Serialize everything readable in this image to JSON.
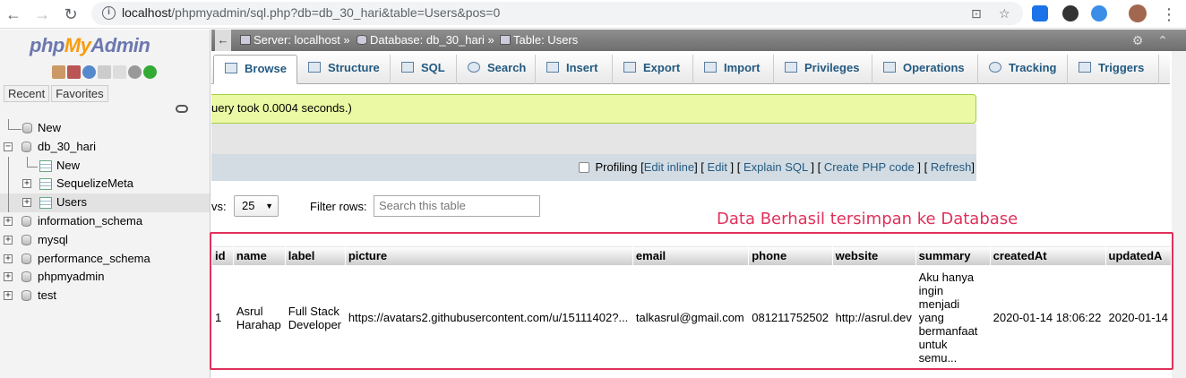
{
  "browser": {
    "url_host": "localhost",
    "url_path": "/phpmyadmin/sql.php?db=db_30_hari&table=Users&pos=0"
  },
  "sidebar": {
    "logo_php": "php",
    "logo_my": "My",
    "logo_admin": "Admin",
    "recent_label": "Recent",
    "favorites_label": "Favorites",
    "tree": [
      {
        "label": "New"
      },
      {
        "label": "db_30_hari"
      },
      {
        "label": "New"
      },
      {
        "label": "SequelizeMeta"
      },
      {
        "label": "Users"
      },
      {
        "label": "information_schema"
      },
      {
        "label": "mysql"
      },
      {
        "label": "performance_schema"
      },
      {
        "label": "phpmyadmin"
      },
      {
        "label": "test"
      }
    ]
  },
  "breadcrumb": {
    "server": "Server: localhost »",
    "database": "Database: db_30_hari »",
    "table": "Table: Users"
  },
  "tabs": [
    {
      "label": "Browse"
    },
    {
      "label": "Structure"
    },
    {
      "label": "SQL"
    },
    {
      "label": "Search"
    },
    {
      "label": "Insert"
    },
    {
      "label": "Export"
    },
    {
      "label": "Import"
    },
    {
      "label": "Privileges"
    },
    {
      "label": "Operations"
    },
    {
      "label": "Tracking"
    },
    {
      "label": "Triggers"
    }
  ],
  "message": {
    "success": "uery took 0.0004 seconds.)"
  },
  "query_toolbar": {
    "profiling": "Profiling",
    "edit_inline": "Edit inline",
    "edit": "Edit",
    "explain_sql": "Explain SQL",
    "create_php": "Create PHP code",
    "refresh": "Refresh"
  },
  "controls": {
    "numrows_label": "vs:",
    "numrows_value": "25",
    "filter_label": "Filter rows:",
    "filter_placeholder": "Search this table"
  },
  "annotation": "Data Berhasil tersimpan ke Database",
  "table": {
    "columns": [
      "id",
      "name",
      "label",
      "picture",
      "email",
      "phone",
      "website",
      "summary",
      "createdAt",
      "updatedA"
    ],
    "row": {
      "id": "1",
      "name": "Asrul Harahap",
      "label": "Full Stack Developer",
      "picture": "https://avatars2.githubusercontent.com/u/15111402?...",
      "email": "talkasrul@gmail.com",
      "phone": "081211752502",
      "website": "http://asrul.dev",
      "summary": "Aku hanya ingin menjadi yang bermanfaat untuk semu...",
      "createdAt": "2020-01-14 18:06:22",
      "updatedAt": "2020-01-14"
    }
  },
  "colors": {
    "accent_link": "#235a81",
    "annotation_red": "#e0305a",
    "success_bg": "#ebf8a4"
  }
}
